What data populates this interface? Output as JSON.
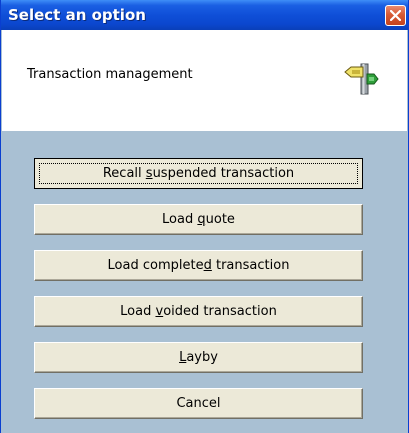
{
  "window": {
    "title": "Select an option",
    "close_icon": "close-icon",
    "accent": "#0a3fd0",
    "close_color": "#d75a35"
  },
  "header": {
    "text": "Transaction management",
    "icon": "signpost-icon"
  },
  "buttons": [
    {
      "pre": "Recall ",
      "mnemonic": "s",
      "post": "uspended transaction",
      "focused": true
    },
    {
      "pre": "Load ",
      "mnemonic": "q",
      "post": "uote"
    },
    {
      "pre": "Load complete",
      "mnemonic": "d",
      "post": " transaction"
    },
    {
      "pre": "Load ",
      "mnemonic": "v",
      "post": "oided transaction"
    },
    {
      "pre": "",
      "mnemonic": "L",
      "post": "ayby"
    },
    {
      "pre": "Cancel",
      "mnemonic": "",
      "post": ""
    }
  ]
}
